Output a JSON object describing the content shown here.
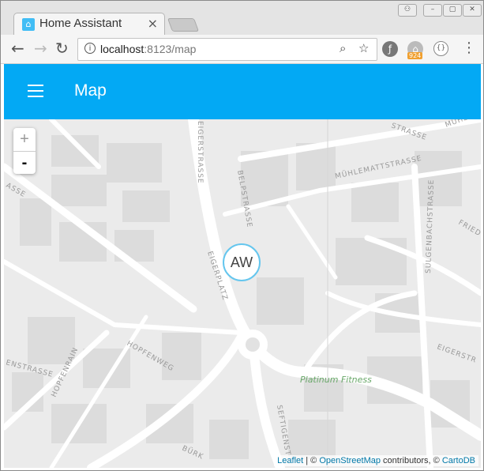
{
  "browser": {
    "tab_title": "Home Assistant",
    "tab_close": "×",
    "url_host": "localhost",
    "url_rest": ":8123/map",
    "ext_badge": "924"
  },
  "app": {
    "title": "Map"
  },
  "map": {
    "zoom_in": "+",
    "zoom_out": "-",
    "marker_label": "AW",
    "streets": [
      "EIGERSTRASSE",
      "BELPSTRASSE",
      "MÜHLEMATTSTRASSE",
      "SULGENBACHSTRASSE",
      "FRIED",
      "EIGERPLATZ",
      "HOPFENWEG",
      "HOPFENRAIN",
      "SEFTIGENST",
      "EIGERSTR",
      "BÜRK",
      "MÜHLE",
      "STRASSE",
      "ENSTRASSE",
      "ASSE"
    ],
    "poi": "Platinum Fitness",
    "attribution": {
      "leaflet": "Leaflet",
      "sep1": " | © ",
      "osm": "OpenStreetMap",
      "contributors": " contributors, © ",
      "carto": "CartoDB"
    }
  },
  "colors": {
    "header": "#03a9f4",
    "marker_border": "#65c6ee"
  }
}
